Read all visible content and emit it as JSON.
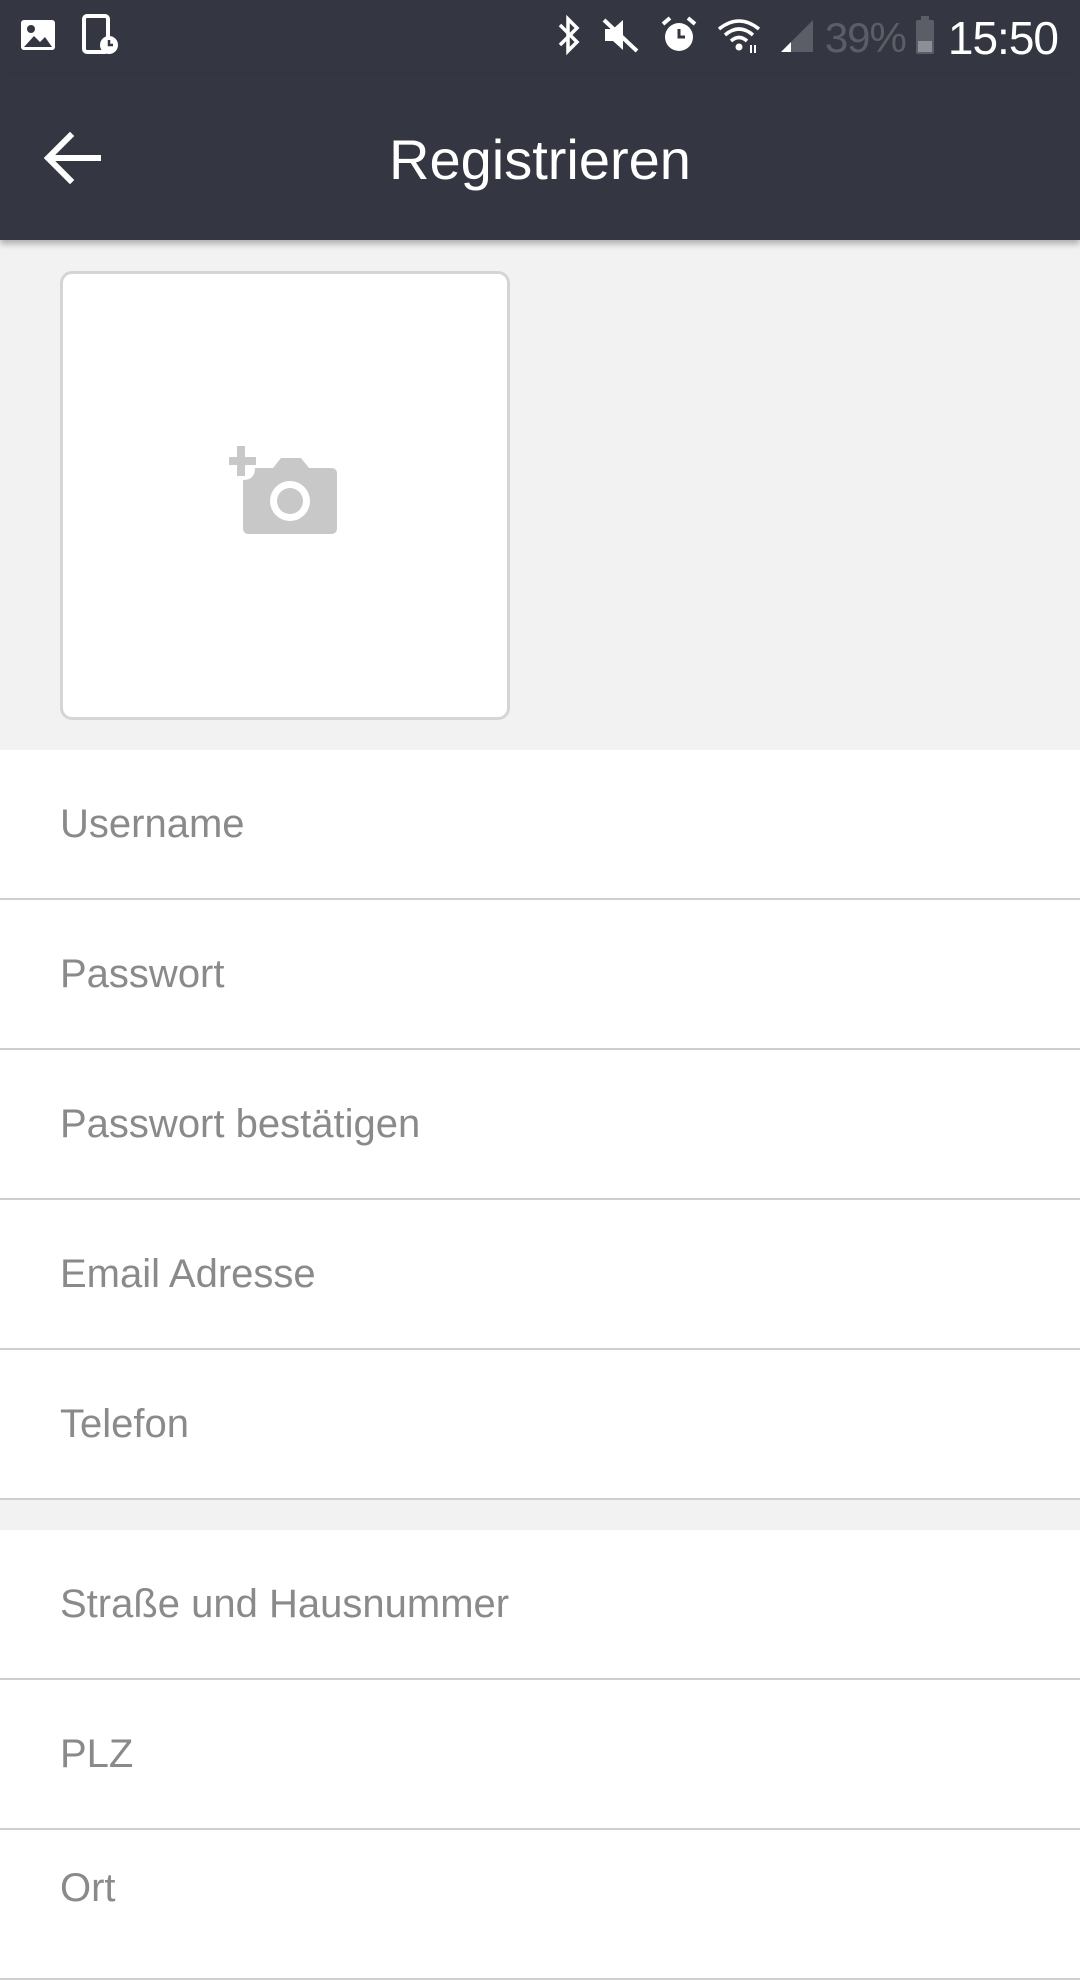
{
  "status_bar": {
    "left_icons": [
      "image-icon",
      "screenshot-icon"
    ],
    "right_icons": [
      "bluetooth-icon",
      "mute-icon",
      "alarm-icon",
      "wifi-icon",
      "signal-icon",
      "battery-icon"
    ],
    "battery": "39%",
    "time": "15:50"
  },
  "app_bar": {
    "title": "Registrieren",
    "background": "#343741",
    "back_icon": "arrow-back-icon"
  },
  "photo": {
    "icon": "add-photo-icon"
  },
  "fields": [
    {
      "placeholder": "Username",
      "value": ""
    },
    {
      "placeholder": "Passwort",
      "value": ""
    },
    {
      "placeholder": "Passwort bestätigen",
      "value": ""
    },
    {
      "placeholder": "Email Adresse",
      "value": ""
    },
    {
      "placeholder": "Telefon",
      "value": ""
    },
    {
      "placeholder": "Straße und Hausnummer",
      "value": ""
    },
    {
      "placeholder": "PLZ",
      "value": ""
    },
    {
      "placeholder": "Ort",
      "value": ""
    }
  ]
}
